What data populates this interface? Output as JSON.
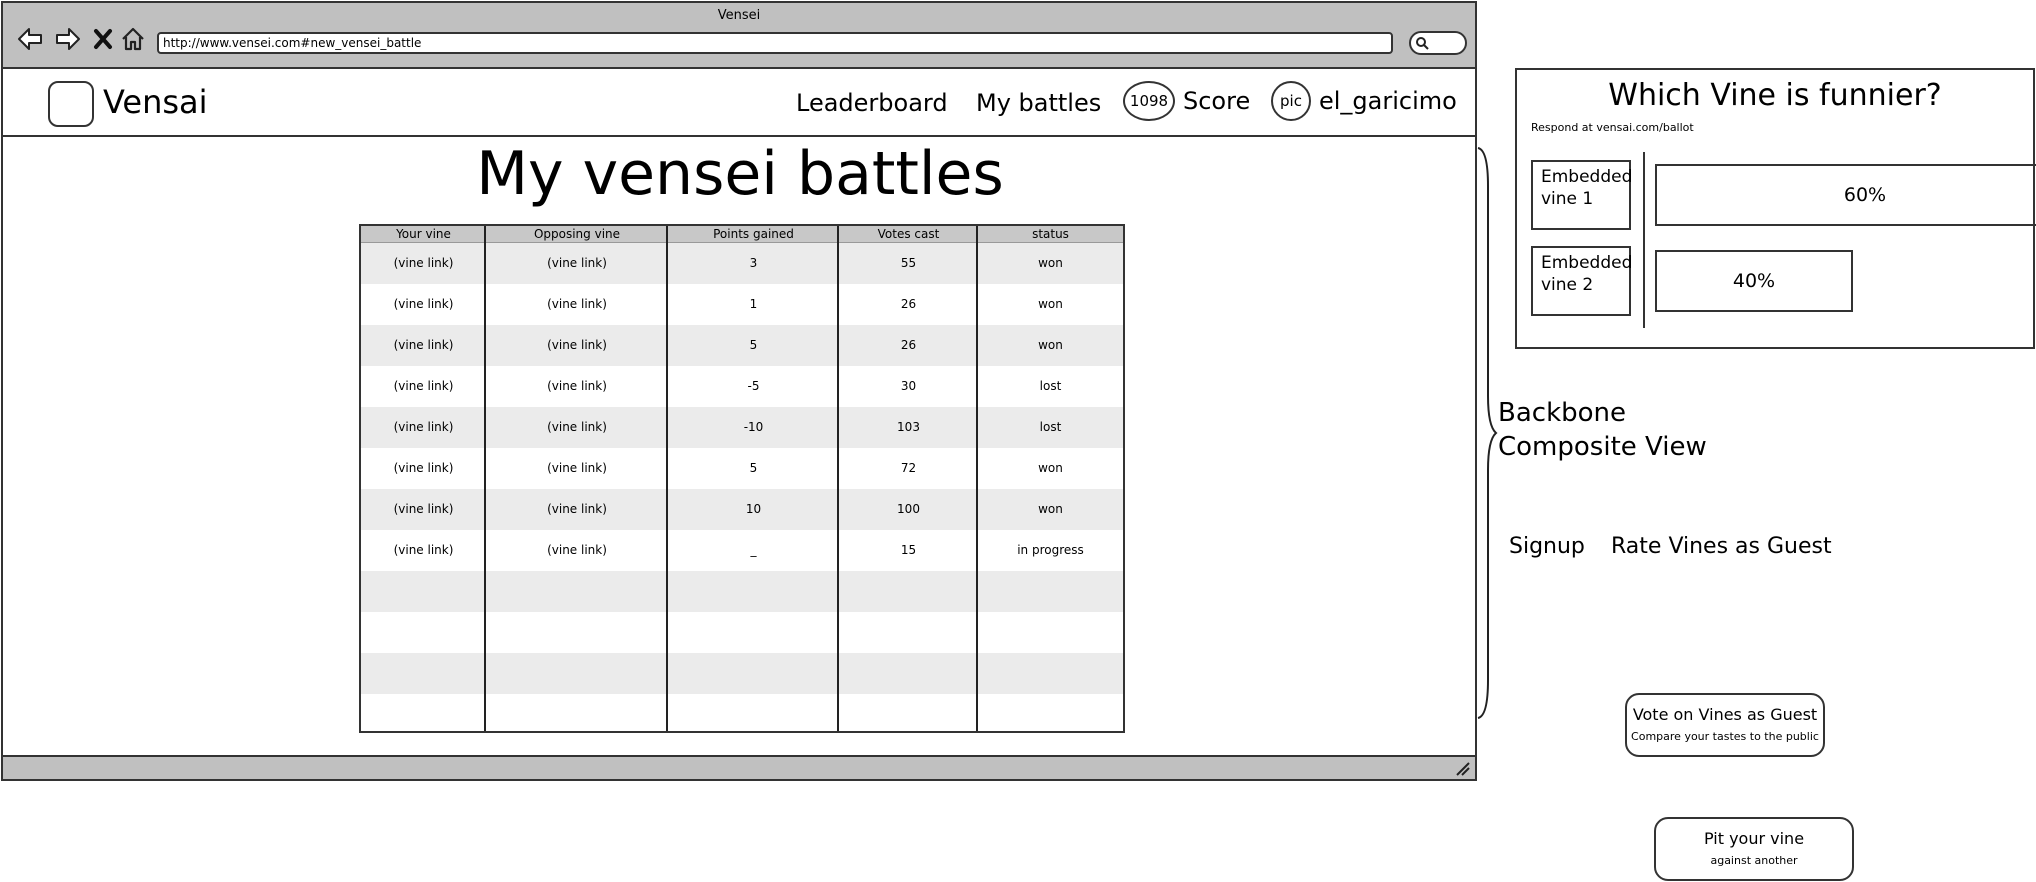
{
  "browser": {
    "window_title": "Vensei",
    "url": "http://www.vensei.com#new_vensei_battle"
  },
  "header": {
    "logo_text": "Vensai",
    "nav": {
      "leaderboard": "Leaderboard",
      "my_battles": "My battles"
    },
    "score_value": "1098",
    "score_label": "Score",
    "avatar_text": "pic",
    "username": "el_garicimo"
  },
  "main": {
    "title": "My vensei battles",
    "table": {
      "columns": [
        "Your vine",
        "Opposing vine",
        "Points gained",
        "Votes cast",
        "status"
      ],
      "rows": [
        [
          "(vine link)",
          "(vine link)",
          "3",
          "55",
          "won"
        ],
        [
          "(vine link)",
          "(vine link)",
          "1",
          "26",
          "won"
        ],
        [
          "(vine link)",
          "(vine link)",
          "5",
          "26",
          "won"
        ],
        [
          "(vine link)",
          "(vine link)",
          "-5",
          "30",
          "lost"
        ],
        [
          "(vine link)",
          "(vine link)",
          "-10",
          "103",
          "lost"
        ],
        [
          "(vine link)",
          "(vine link)",
          "5",
          "72",
          "won"
        ],
        [
          "(vine link)",
          "(vine link)",
          "10",
          "100",
          "won"
        ],
        [
          "(vine link)",
          "(vine link)",
          "_",
          "15",
          "in progress"
        ],
        [
          "",
          "",
          "",
          "",
          ""
        ],
        [
          "",
          "",
          "",
          "",
          ""
        ],
        [
          "",
          "",
          "",
          "",
          ""
        ],
        [
          "",
          "",
          "",
          "",
          ""
        ]
      ]
    }
  },
  "annotations": {
    "backbone_line1": "Backbone",
    "backbone_line2": "Composite View"
  },
  "ballot": {
    "title": "Which Vine is funnier?",
    "subtitle": "Respond at vensai.com/ballot",
    "vine1_label": "Embedded vine 1",
    "vine2_label": "Embedded vine 2",
    "vine1_pct": "60%",
    "vine2_pct": "40%",
    "vine1_share": 0.6,
    "vine2_share": 0.4
  },
  "guest_links": {
    "signup": "Signup",
    "rate_as_guest": "Rate Vines as Guest"
  },
  "buttons": {
    "vote_guest_main": "Vote on Vines as Guest",
    "vote_guest_sub": "Compare your tastes to the public",
    "pit_vine_main": "Pit your vine",
    "pit_vine_sub": "against another"
  }
}
